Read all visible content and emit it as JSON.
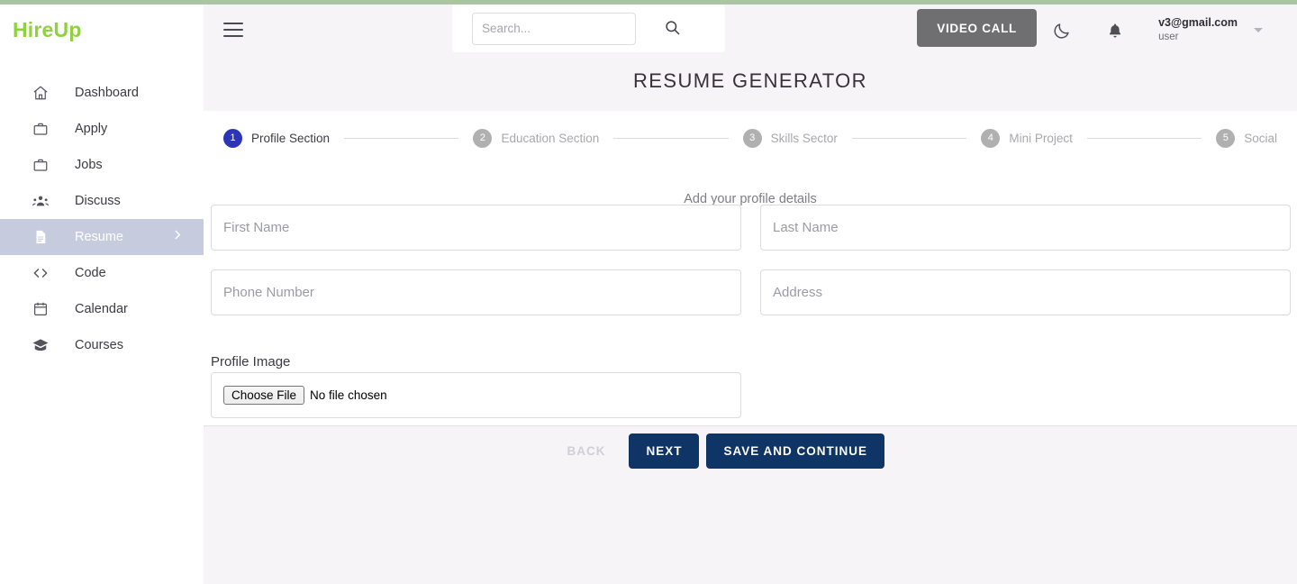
{
  "brand": {
    "name": "HireUp"
  },
  "sidebar": {
    "items": [
      {
        "label": "Dashboard",
        "icon": "home-icon",
        "active": false
      },
      {
        "label": "Apply",
        "icon": "briefcase-icon",
        "active": false
      },
      {
        "label": "Jobs",
        "icon": "briefcase-icon",
        "active": false
      },
      {
        "label": "Discuss",
        "icon": "people-icon",
        "active": false
      },
      {
        "label": "Resume",
        "icon": "document-icon",
        "active": true,
        "chevron": "chevron-right-icon"
      },
      {
        "label": "Code",
        "icon": "code-icon",
        "active": false
      },
      {
        "label": "Calendar",
        "icon": "calendar-icon",
        "active": false
      },
      {
        "label": "Courses",
        "icon": "graduation-cap-icon",
        "active": false
      }
    ]
  },
  "header": {
    "menu_icon": "hamburger-icon",
    "search": {
      "placeholder": "Search...",
      "value": "",
      "icon": "search-icon"
    },
    "video_call_label": "VIDEO CALL",
    "dark_mode_icon": "moon-icon",
    "notifications_icon": "bell-icon",
    "user": {
      "email": "v3@gmail.com",
      "role": "user",
      "caret": "chevron-down-icon"
    }
  },
  "page": {
    "title": "RESUME GENERATOR"
  },
  "stepper": {
    "steps": [
      {
        "number": "1",
        "label": "Profile Section",
        "active": true
      },
      {
        "number": "2",
        "label": "Education Section",
        "active": false
      },
      {
        "number": "3",
        "label": "Skills Sector",
        "active": false
      },
      {
        "number": "4",
        "label": "Mini Project",
        "active": false
      },
      {
        "number": "5",
        "label": "Social",
        "active": false
      }
    ]
  },
  "form": {
    "subtitle": "Add your profile details",
    "fields": [
      {
        "name": "first-name",
        "placeholder": "First Name",
        "value": ""
      },
      {
        "name": "last-name",
        "placeholder": "Last Name",
        "value": ""
      },
      {
        "name": "phone-number",
        "placeholder": "Phone Number",
        "value": ""
      },
      {
        "name": "address",
        "placeholder": "Address",
        "value": ""
      }
    ],
    "profile_image_label": "Profile Image",
    "file_button_label": "Choose File",
    "file_status": "No file chosen"
  },
  "actions": {
    "back_label": "BACK",
    "next_label": "NEXT",
    "save_label": "SAVE AND CONTINUE"
  },
  "colors": {
    "brand_green": "#8fd13f",
    "top_strip": "#a9c5a2",
    "active_step": "#2b35b5",
    "primary_button": "#0f3566",
    "video_call": "#6f6f71",
    "sidebar_active": "#c6ccdd",
    "page_bg": "#f7f4f7"
  }
}
